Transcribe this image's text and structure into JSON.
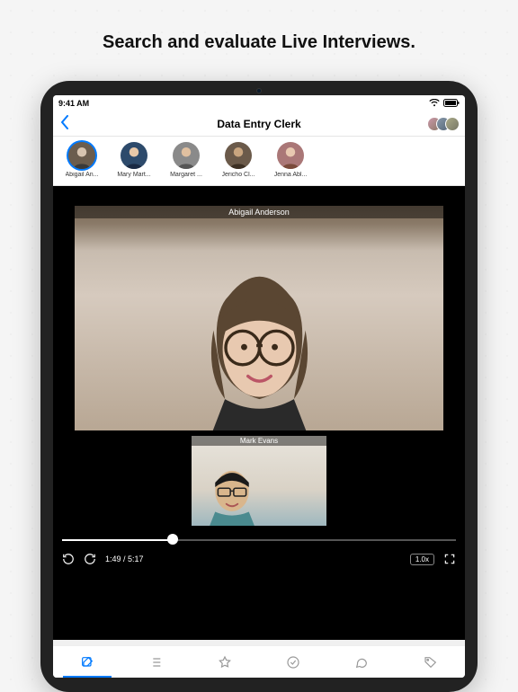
{
  "headline": "Search and evaluate Live Interviews.",
  "statusbar": {
    "time": "9:41 AM"
  },
  "navbar": {
    "title": "Data Entry Clerk"
  },
  "candidates": [
    {
      "name": "Abigail An...",
      "selected": true
    },
    {
      "name": "Mary Mart...",
      "selected": false
    },
    {
      "name": "Margaret ...",
      "selected": false
    },
    {
      "name": "Jericho Cl...",
      "selected": false
    },
    {
      "name": "Jenna Abl...",
      "selected": false
    }
  ],
  "video": {
    "main_label": "Abigail Anderson",
    "pip_label": "Mark Evans"
  },
  "player": {
    "time": "1:49 / 5:17",
    "speed": "1.0x",
    "progress_pct": 28
  },
  "icons": {
    "compose": "compose",
    "list": "list",
    "star": "star",
    "check": "check",
    "chat": "chat",
    "tag": "tag"
  },
  "colors": {
    "accent": "#007aff"
  }
}
